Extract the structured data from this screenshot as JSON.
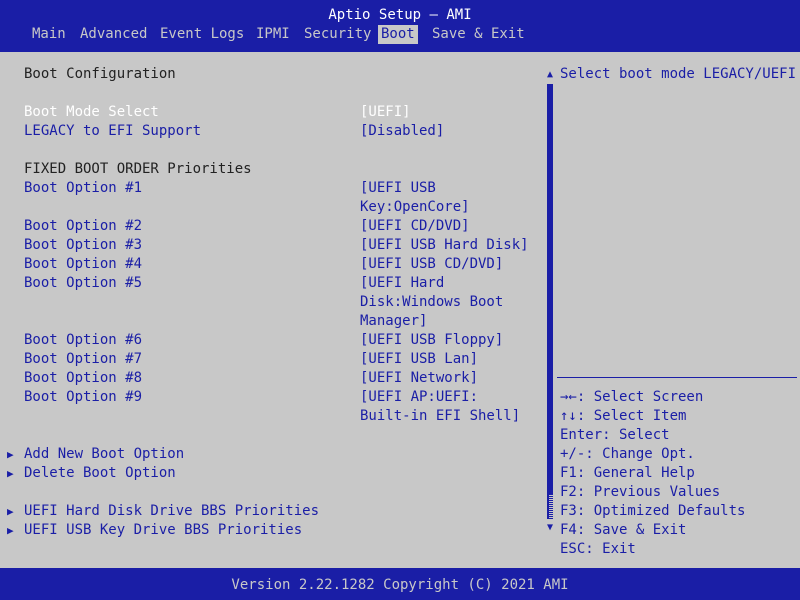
{
  "header": {
    "title": "Aptio Setup – AMI",
    "tabs": [
      {
        "label": "Main"
      },
      {
        "label": "Advanced"
      },
      {
        "label": "Event Logs"
      },
      {
        "label": "IPMI"
      },
      {
        "label": "Security"
      },
      {
        "label": "Boot"
      },
      {
        "label": "Save & Exit"
      }
    ],
    "active_tab": "Boot"
  },
  "boot": {
    "section_title": "Boot Configuration",
    "boot_mode_label": "Boot Mode Select",
    "boot_mode_value": "[UEFI]",
    "legacy_label": "LEGACY to EFI Support",
    "legacy_value": "[Disabled]",
    "fixed_order_title": "FIXED BOOT ORDER Priorities",
    "options": [
      {
        "label": "Boot Option #1",
        "value_lines": [
          "[UEFI USB",
          "Key:OpenCore]"
        ]
      },
      {
        "label": "Boot Option #2",
        "value_lines": [
          "[UEFI CD/DVD]"
        ]
      },
      {
        "label": "Boot Option #3",
        "value_lines": [
          "[UEFI USB Hard Disk]"
        ]
      },
      {
        "label": "Boot Option #4",
        "value_lines": [
          "[UEFI USB CD/DVD]"
        ]
      },
      {
        "label": "Boot Option #5",
        "value_lines": [
          "[UEFI Hard",
          "Disk:Windows Boot",
          "Manager]"
        ]
      },
      {
        "label": "Boot Option #6",
        "value_lines": [
          "[UEFI USB Floppy]"
        ]
      },
      {
        "label": "Boot Option #7",
        "value_lines": [
          "[UEFI USB Lan]"
        ]
      },
      {
        "label": "Boot Option #8",
        "value_lines": [
          "[UEFI Network]"
        ]
      },
      {
        "label": "Boot Option #9",
        "value_lines": [
          "[UEFI AP:UEFI:",
          "Built-in EFI Shell]"
        ]
      }
    ],
    "submenus": [
      "Add New Boot Option",
      "Delete Boot Option",
      "UEFI Hard Disk Drive BBS Priorities",
      "UEFI USB Key Drive BBS Priorities"
    ]
  },
  "help": {
    "description": "Select boot mode LEGACY/UEFI",
    "keys": [
      "→←: Select Screen",
      "↑↓: Select Item",
      "Enter: Select",
      "+/-: Change Opt.",
      "F1: General Help",
      "F2: Previous Values",
      "F3: Optimized Defaults",
      "F4: Save & Exit",
      "ESC: Exit"
    ]
  },
  "footer": {
    "text": "Version 2.22.1282 Copyright (C) 2021 AMI"
  },
  "colors": {
    "background": "#1a1ea6",
    "panel": "#c8c8c8",
    "highlight": "#ffffff"
  },
  "icons": {
    "submenu": "right-triangle-icon",
    "scroll_up": "scroll-up-arrow-icon",
    "scroll_down": "scroll-down-arrow-icon"
  }
}
